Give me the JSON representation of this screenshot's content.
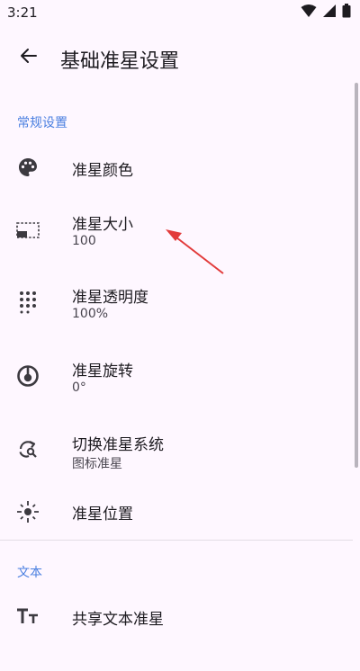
{
  "status_bar": {
    "time": "3:21"
  },
  "app_bar": {
    "title": "基础准星设置"
  },
  "sections": [
    {
      "header": "常规设置"
    },
    {
      "header": "文本"
    }
  ],
  "items": [
    {
      "icon": "palette-icon",
      "title": "准星颜色",
      "subtitle": ""
    },
    {
      "icon": "size-icon",
      "title": "准星大小",
      "subtitle": "100"
    },
    {
      "icon": "dots-grid-icon",
      "title": "准星透明度",
      "subtitle": "100%"
    },
    {
      "icon": "rotate-icon",
      "title": "准星旋转",
      "subtitle": "0°"
    },
    {
      "icon": "switch-icon",
      "title": "切换准星系统",
      "subtitle": "图标准星"
    },
    {
      "icon": "crosshair-icon",
      "title": "准星位置",
      "subtitle": ""
    },
    {
      "icon": "text-icon",
      "title": "共享文本准星",
      "subtitle": ""
    }
  ],
  "colors": {
    "accent": "#4a7fe0",
    "annotation_arrow": "#e23b3b",
    "background": "#FEF7FF"
  }
}
